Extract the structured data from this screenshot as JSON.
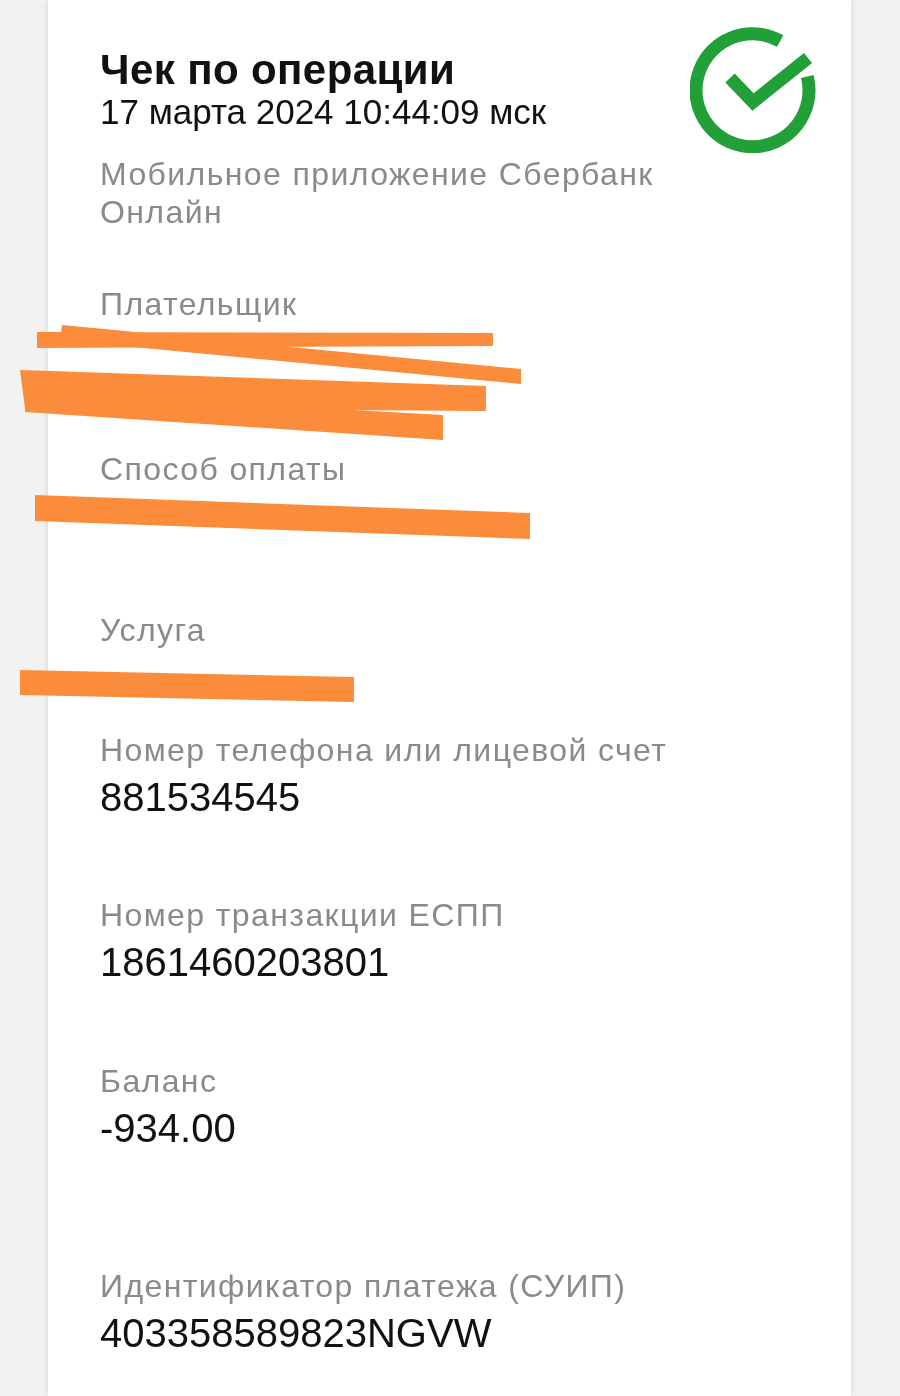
{
  "receipt": {
    "title": "Чек по операции",
    "datetime": "17 марта 2024 10:44:09 мск",
    "source": "Мобильное приложение Сбербанк Онлайн"
  },
  "fields": [
    {
      "label": "Плательщик",
      "kind": "redacted"
    },
    {
      "label": "Способ оплаты",
      "kind": "redacted"
    },
    {
      "label": "Услуга",
      "kind": "redacted"
    },
    {
      "label": "Номер телефона или лицевой счет",
      "kind": "text",
      "value": "881534545"
    },
    {
      "label": "Номер транзакции ЕСПП",
      "kind": "text",
      "value": "1861460203801"
    },
    {
      "label": "Баланс",
      "kind": "text",
      "value": "-934.00"
    },
    {
      "label": "Идентификатор платежа (СУИП)",
      "kind": "text",
      "value": "403358589823NGVW"
    }
  ]
}
